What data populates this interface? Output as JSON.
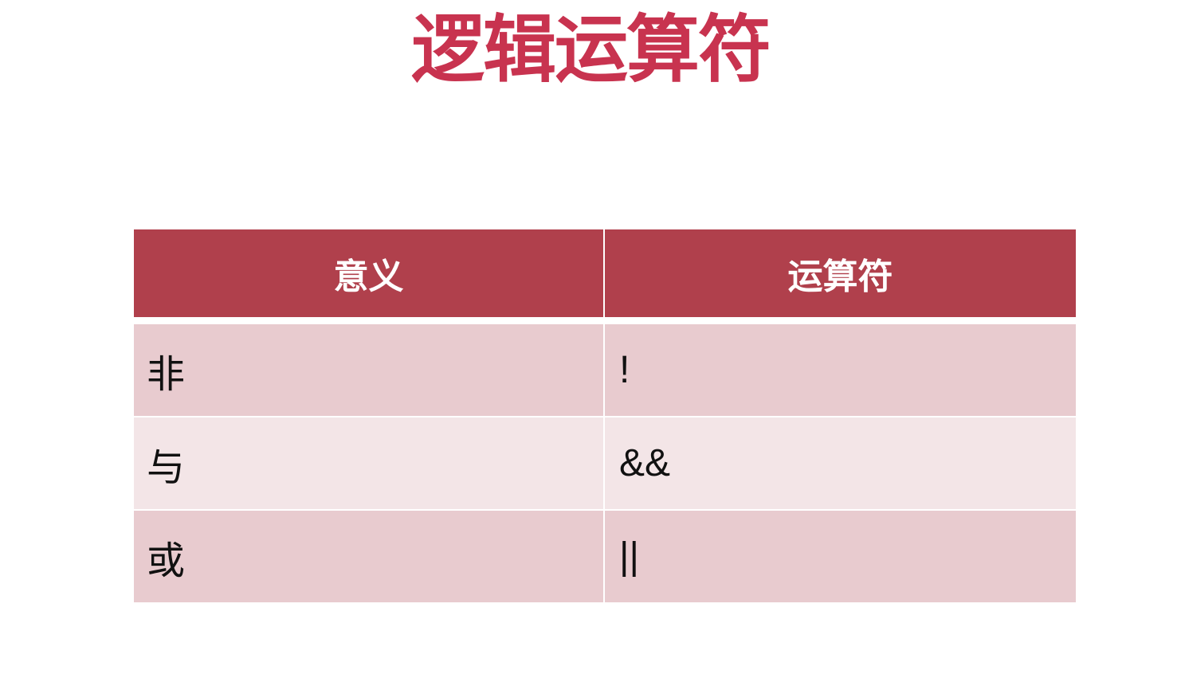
{
  "title": "逻辑运算符",
  "table": {
    "headers": [
      "意义",
      "运算符"
    ],
    "rows": [
      {
        "meaning": "非",
        "operator": "!"
      },
      {
        "meaning": "与",
        "operator": "&&"
      },
      {
        "meaning": "或",
        "operator": "||"
      }
    ]
  },
  "colors": {
    "title": "#c8334f",
    "header_bg": "#b0404c",
    "row_dark": "#e8cbcf",
    "row_light": "#f3e5e7"
  }
}
